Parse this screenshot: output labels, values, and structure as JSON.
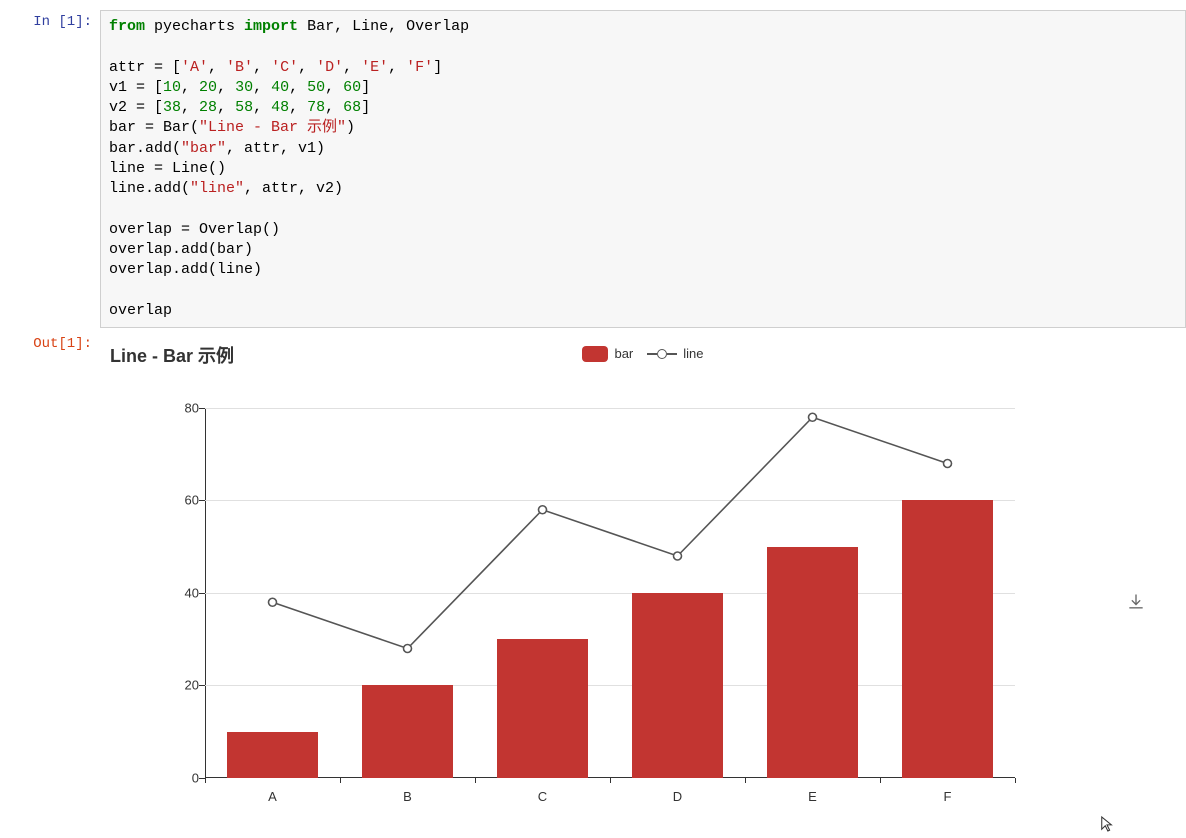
{
  "cell": {
    "in_prompt": "In [1]:",
    "out_prompt": "Out[1]:"
  },
  "code": {
    "line1_a": "from",
    "line1_b": " pyecharts ",
    "line1_c": "import",
    "line1_d": " Bar, Line, Overlap",
    "line3_a": "attr = [",
    "line3_b": "'A'",
    "line3_c": ", ",
    "line3_d": "'B'",
    "line3_e": "'C'",
    "line3_f": "'D'",
    "line3_g": "'E'",
    "line3_h": "'F'",
    "line3_i": "]",
    "line4_a": "v1 = [",
    "line4_nums": [
      "10",
      "20",
      "30",
      "40",
      "50",
      "60"
    ],
    "line5_a": "v2 = [",
    "line5_nums": [
      "38",
      "28",
      "58",
      "48",
      "78",
      "68"
    ],
    "line6_a": "bar = Bar(",
    "line6_b": "\"Line - Bar 示例\"",
    "line6_c": ")",
    "line7_a": "bar.add(",
    "line7_b": "\"bar\"",
    "line7_c": ", attr, v1)",
    "line8": "line = Line()",
    "line9_a": "line.add(",
    "line9_b": "\"line\"",
    "line9_c": ", attr, v2)",
    "line11": "overlap = Overlap()",
    "line12": "overlap.add(bar)",
    "line13": "overlap.add(line)",
    "line15": "overlap"
  },
  "chart": {
    "title": "Line - Bar 示例",
    "legend_bar": "bar",
    "legend_line": "line",
    "yticks": [
      "0",
      "20",
      "40",
      "60",
      "80"
    ]
  },
  "chart_data": {
    "type": "bar+line",
    "title": "Line - Bar 示例",
    "categories": [
      "A",
      "B",
      "C",
      "D",
      "E",
      "F"
    ],
    "series": [
      {
        "name": "bar",
        "type": "bar",
        "values": [
          10,
          20,
          30,
          40,
          50,
          60
        ]
      },
      {
        "name": "line",
        "type": "line",
        "values": [
          38,
          28,
          58,
          48,
          78,
          68
        ]
      }
    ],
    "xlabel": "",
    "ylabel": "",
    "ylim": [
      0,
      80
    ],
    "yticks": [
      0,
      20,
      40,
      60,
      80
    ],
    "grid": true,
    "legend_position": "top-center",
    "colors": {
      "bar": "#c23531",
      "line": "#555555"
    }
  }
}
